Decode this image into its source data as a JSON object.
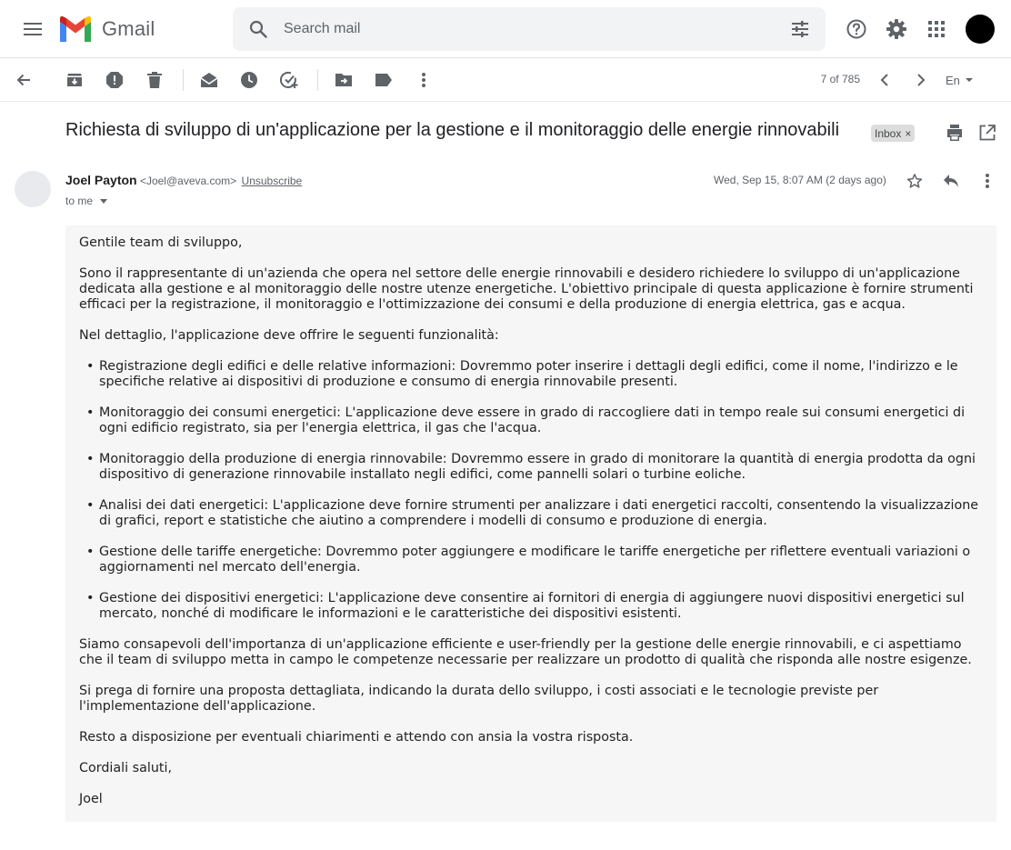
{
  "header": {
    "menu_icon": "hamburger-menu-icon",
    "app_name": "Gmail",
    "search": {
      "placeholder": "Search mail",
      "value": ""
    },
    "icons": [
      "search-icon",
      "search-options-icon",
      "help-icon",
      "gear-icon",
      "apps-grid-icon",
      "account-avatar"
    ]
  },
  "toolbar": {
    "icons": [
      "back-arrow-icon",
      "archive-icon",
      "report-spam-icon",
      "delete-icon",
      "mark-unread-icon",
      "snooze-icon",
      "add-task-icon",
      "move-to-icon",
      "label-icon",
      "more-vert-icon"
    ],
    "pager": "7 of 785",
    "language": "En"
  },
  "email": {
    "subject": "Richiesta di sviluppo di un'applicazione per la gestione e il monitoraggio delle energie rinnovabili",
    "label": "Inbox",
    "label_close": "×",
    "sender_name": "Joel Payton",
    "sender_email": "<Joel@aveva.com>",
    "unsubscribe": "Unsubscribe",
    "recipient": "to me",
    "date": "Wed, Sep 15, 8:07 AM (2 days ago)",
    "body": {
      "greeting": "Gentile team di sviluppo,",
      "intro": "Sono il rappresentante di un'azienda che opera nel settore delle energie rinnovabili e desidero richiedere lo sviluppo di un'applicazione dedicata alla gestione e al monitoraggio delle nostre utenze energetiche. L'obiettivo principale di questa applicazione è fornire strumenti efficaci per la registrazione, il monitoraggio e l'ottimizzazione dei consumi e della produzione di energia elettrica, gas e acqua.",
      "features_intro": "Nel dettaglio, l'applicazione deve offrire le seguenti funzionalità:",
      "features": [
        "Registrazione degli edifici e delle relative informazioni: Dovremmo poter inserire i dettagli degli edifici, come il nome, l'indirizzo e le specifiche relative ai dispositivi di produzione e consumo di energia rinnovabile presenti.",
        "Monitoraggio dei consumi energetici: L'applicazione deve essere in grado di raccogliere dati in tempo reale sui consumi energetici di ogni edificio registrato, sia per l'energia elettrica, il gas che l'acqua.",
        "Monitoraggio della produzione di energia rinnovabile: Dovremmo essere in grado di monitorare la quantità di energia prodotta da ogni dispositivo di generazione rinnovabile installato negli edifici, come pannelli solari o turbine eoliche.",
        "Analisi dei dati energetici: L'applicazione deve fornire strumenti per analizzare i dati energetici raccolti, consentendo la visualizzazione di grafici, report e statistiche che aiutino a comprendere i modelli di consumo e produzione di energia.",
        "Gestione delle tariffe energetiche: Dovremmo poter aggiungere e modificare le tariffe energetiche per riflettere eventuali variazioni o aggiornamenti nel mercato dell'energia.",
        "Gestione dei dispositivi energetici: L'applicazione deve consentire ai fornitori di energia di aggiungere nuovi dispositivi energetici sul mercato, nonché di modificare le informazioni e le caratteristiche dei dispositivi esistenti."
      ],
      "paragraph_2": "Siamo consapevoli dell'importanza di un'applicazione efficiente e user-friendly per la gestione delle energie rinnovabili, e ci aspettiamo che il team di sviluppo metta in campo le competenze necessarie per realizzare un prodotto di qualità che risponda alle nostre esigenze.",
      "paragraph_3": "Si prega di fornire una proposta dettagliata, indicando la durata dello sviluppo, i costi associati e le tecnologie previste per l'implementazione dell'applicazione.",
      "paragraph_4": "Resto a disposizione per eventuali chiarimenti e attendo con ansia la vostra risposta.",
      "closing": "Cordiali saluti,",
      "signature": "Joel"
    }
  },
  "message_actions": [
    "print-icon",
    "open-new-window-icon",
    "star-icon",
    "reply-icon",
    "more-vert-icon"
  ],
  "colors": {
    "gmail_red": "#EA4335",
    "gmail_blue": "#4285F4",
    "gmail_green": "#34A853",
    "gmail_yellow": "#FBBC04",
    "icon_gray": "#5f6368",
    "search_bg": "#f1f3f4",
    "body_bg": "#f6f6f6"
  }
}
